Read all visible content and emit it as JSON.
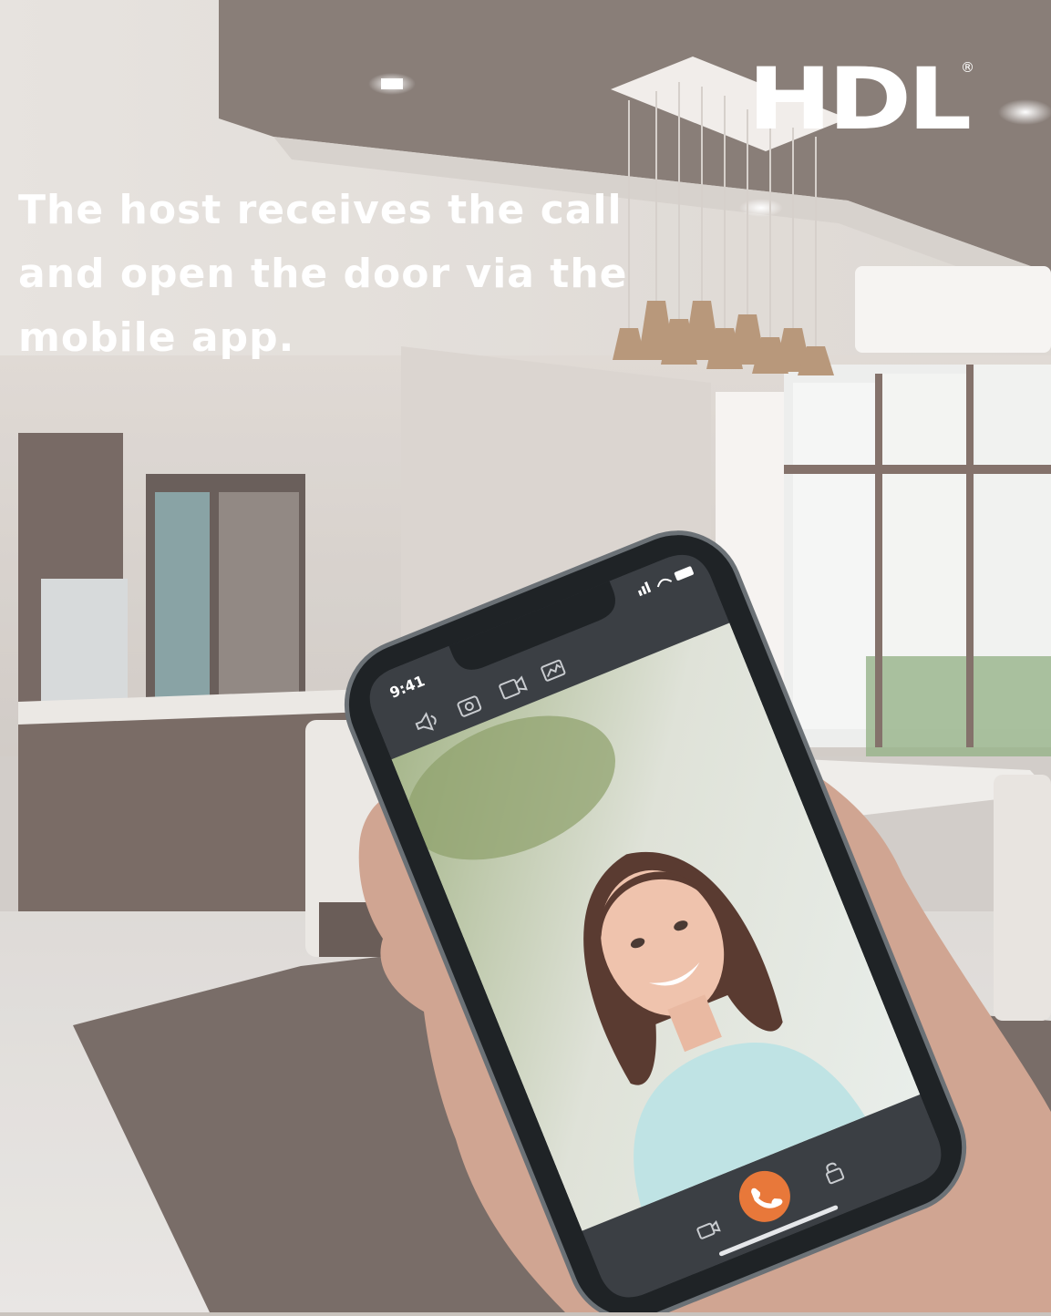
{
  "brand": {
    "name": "HDL",
    "registered": "®"
  },
  "headline": {
    "lines": [
      "The host receives the call",
      "and open the door via the",
      "mobile app."
    ]
  },
  "phone": {
    "status_time": "9:41",
    "toolbar_icons": [
      "speaker-icon",
      "camera-icon",
      "video-record-icon",
      "gallery-icon"
    ],
    "bottom_icons": [
      "video-icon",
      "answer-call-icon",
      "unlock-icon"
    ],
    "accent_color": "#e8783a",
    "screen_bg": "#3b3f44"
  }
}
